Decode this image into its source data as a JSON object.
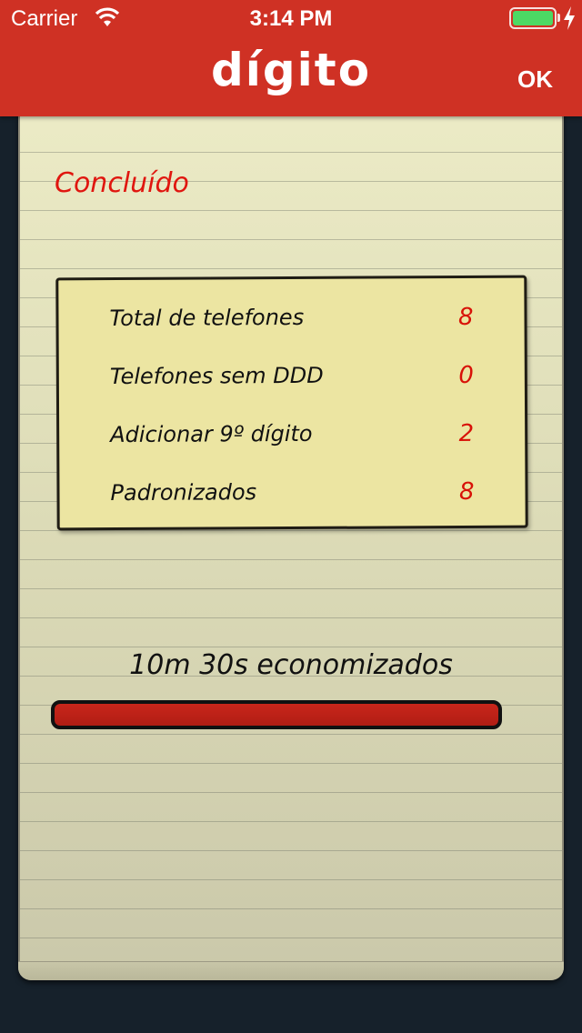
{
  "status_bar": {
    "carrier": "Carrier",
    "time": "3:14 PM",
    "battery_color": "#4cd964"
  },
  "navbar": {
    "title": "dígito",
    "ok_label": "OK",
    "background": "#cf3124"
  },
  "summary": {
    "heading": "Concluído",
    "rows": [
      {
        "label": "Total de telefones",
        "value": "8"
      },
      {
        "label": "Telefones sem DDD",
        "value": "0"
      },
      {
        "label": "Adicionar 9º dígito",
        "value": "2"
      },
      {
        "label": "Padronizados",
        "value": "8"
      }
    ]
  },
  "savings": {
    "text": "10m 30s economizados",
    "progress_percent": 100,
    "bar_color": "#c9261b"
  }
}
